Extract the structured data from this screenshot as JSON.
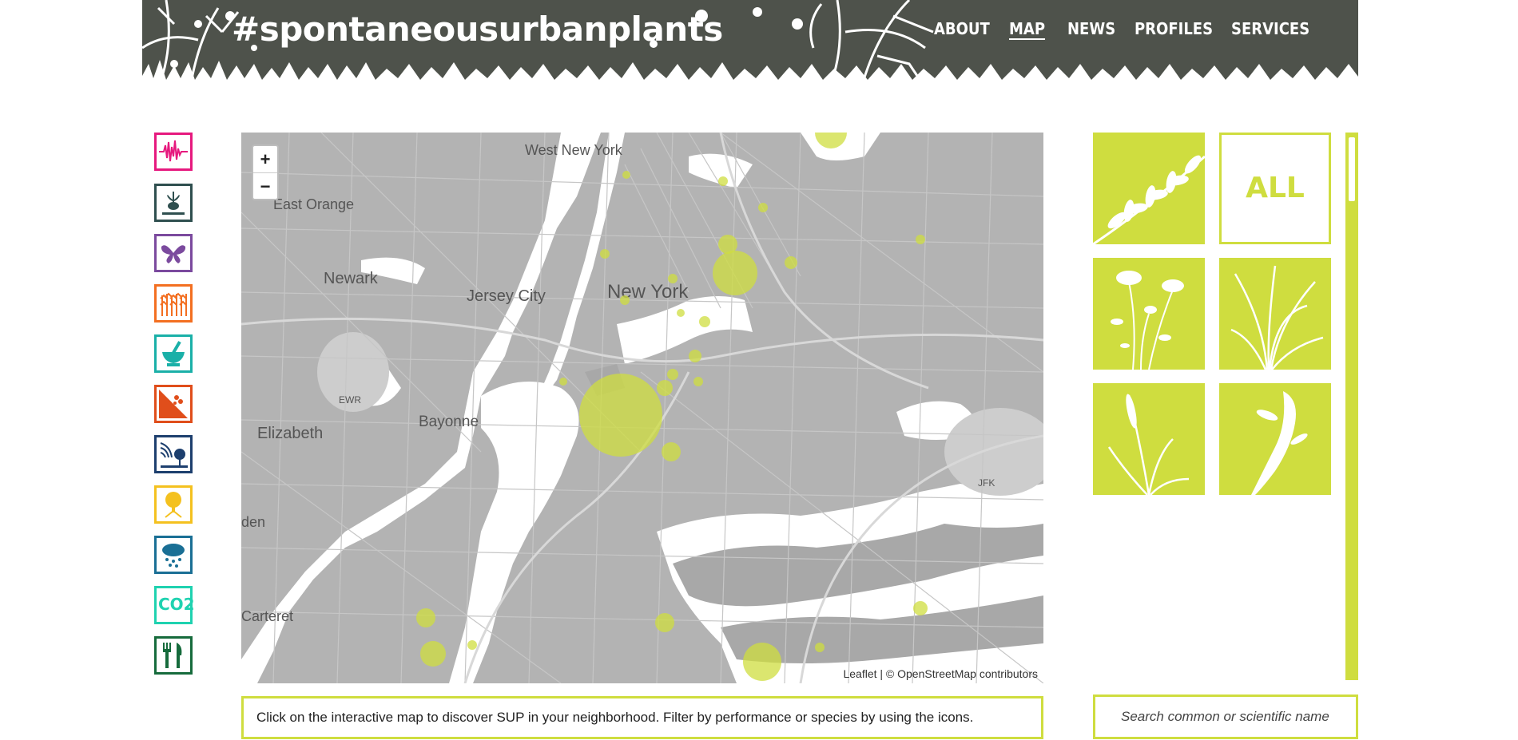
{
  "header": {
    "logo": "#spontaneousurbanplants",
    "nav": [
      "ABOUT",
      "MAP",
      "NEWS",
      "PROFILES",
      "SERVICES"
    ],
    "active_nav": "MAP"
  },
  "performance_icons": [
    {
      "name": "seismograph-icon",
      "color": "#e6197e"
    },
    {
      "name": "plant-roots-icon",
      "color": "#2f4f4f"
    },
    {
      "name": "butterfly-icon",
      "color": "#7b4a9e"
    },
    {
      "name": "crop-field-icon",
      "color": "#f36f21"
    },
    {
      "name": "mortar-pestle-icon",
      "color": "#1ab0a8"
    },
    {
      "name": "soil-erosion-icon",
      "color": "#e04e1b"
    },
    {
      "name": "noise-tree-icon",
      "color": "#1d3f6e"
    },
    {
      "name": "tree-shade-icon",
      "color": "#f4c11f"
    },
    {
      "name": "rain-cloud-icon",
      "color": "#1a6f95"
    },
    {
      "name": "co2-icon",
      "color": "#1fd2b0"
    },
    {
      "name": "fork-knife-icon",
      "color": "#166b3c"
    }
  ],
  "co2_label": "CO2",
  "map": {
    "zoom_in": "+",
    "zoom_out": "−",
    "attribution": "Leaflet | © OpenStreetMap contributors",
    "places": [
      "West New York",
      "East Orange",
      "Newark",
      "Jersey City",
      "New York",
      "Elizabeth",
      "Bayonne",
      "den",
      "Carteret",
      "JFK",
      "EWR"
    ]
  },
  "info_text": "Click on the interactive map to discover SUP in your neighborhood. Filter by performance or species by using the icons.",
  "species_tiles": [
    {
      "name": "leaf-species-tile"
    },
    {
      "name": "all-species-tile",
      "label": "ALL"
    },
    {
      "name": "queen-annes-lace-tile"
    },
    {
      "name": "grass-species-tile"
    },
    {
      "name": "reed-species-tile"
    },
    {
      "name": "weed-species-tile"
    }
  ],
  "search": {
    "placeholder": "Search common or scientific name"
  },
  "accent": "#cfdd3f"
}
